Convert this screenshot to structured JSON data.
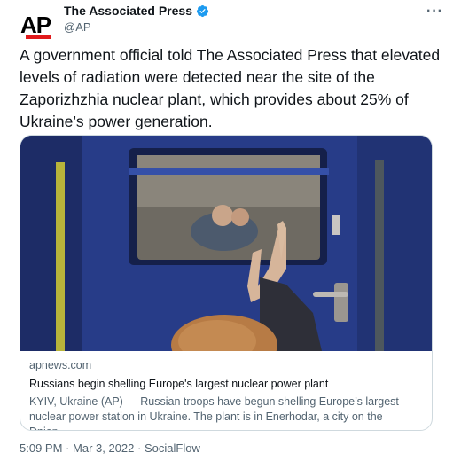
{
  "author": {
    "display_name": "The Associated Press",
    "handle": "@AP",
    "logo_text": "AP",
    "verified_icon": "verified-badge-icon",
    "brand_color": "#e1191b"
  },
  "menu": {
    "icon": "more-options-icon",
    "glyph": "···"
  },
  "tweet": {
    "text": "A government official told The Associated Press that elevated levels of radiation were detected near the site of the Zaporizhzhia nuclear plant, which provides about 25% of Ukraine’s power generation."
  },
  "card": {
    "domain": "apnews.com",
    "title": "Russians begin shelling Europe's largest nuclear power plant",
    "description": "KYIV, Ukraine (AP) — Russian troops have begun shelling Europe’s largest nuclear power station in Ukraine. The plant is in Enerhodar, a city on the Dniep…"
  },
  "meta": {
    "time": "5:09 PM",
    "separator": "·",
    "date": "Mar 3, 2022",
    "source": "SocialFlow"
  },
  "colors": {
    "text_primary": "#0f1419",
    "text_secondary": "#536471",
    "verified_blue": "#1d9bf0",
    "card_border": "#cfd9de",
    "train_blue": "#2a3f8f"
  }
}
